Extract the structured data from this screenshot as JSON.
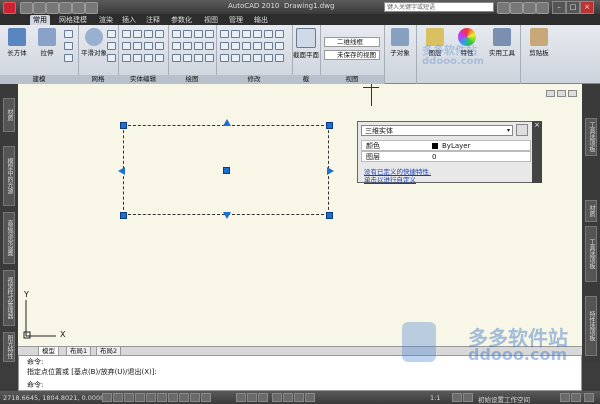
{
  "titlebar": {
    "app_title": "AutoCAD 2010",
    "file_name": "Drawing1.dwg",
    "search_placeholder": "键入关键字或短语"
  },
  "tabs": [
    "常用",
    "网格建模",
    "渲染",
    "插入",
    "注释",
    "参数化",
    "视图",
    "管理",
    "输出"
  ],
  "ribbon": {
    "panels": [
      {
        "title": "建模",
        "buttons": [
          "长方体",
          "拉伸"
        ]
      },
      {
        "title": "网格",
        "buttons": [
          "平滑对象"
        ]
      },
      {
        "title": "实体编辑",
        "buttons": []
      },
      {
        "title": "绘图",
        "buttons": []
      },
      {
        "title": "修改",
        "buttons": []
      },
      {
        "title": "截",
        "buttons": [
          "截面平面"
        ]
      },
      {
        "title": "视图",
        "buttons": []
      },
      {
        "title": "",
        "buttons": [
          "子对象"
        ]
      },
      {
        "title": "",
        "buttons": [
          "图层",
          "特性",
          "实用工具"
        ]
      },
      {
        "title": "",
        "buttons": [
          "剪贴板"
        ]
      }
    ],
    "visual_style": "二维线框",
    "view_state": "未保存的视图"
  },
  "left_palettes": [
    "材质",
    "模型中的光源",
    "高级渲染设置",
    "视觉样式管理器",
    "阳光特性"
  ],
  "right_palettes": [
    "工具选项板",
    "材质",
    "工具选项板",
    "特性选项板"
  ],
  "quick_properties": {
    "object_type": "三维实体",
    "rows": [
      {
        "label": "颜色",
        "value": "ByLayer"
      },
      {
        "label": "图层",
        "value": "0"
      }
    ],
    "link1": "没有已定义的快捷特性.",
    "link2": "单击以进行自定义"
  },
  "layout_tabs": [
    "模型",
    "布局1",
    "布局2"
  ],
  "command_lines": [
    "命令:",
    "指定点位置或 [基点(B)/放弃(U)/退出(X)]:",
    "命令:"
  ],
  "ucs": {
    "x_label": "X",
    "y_label": "Y"
  },
  "status": {
    "coordinates": "2718.6645, 1804.8021, 0.0000",
    "scale": "1:1",
    "workspace": "初始设置工作空间"
  },
  "watermark": {
    "brand": "多多软件站",
    "url": "ddooo.com"
  }
}
